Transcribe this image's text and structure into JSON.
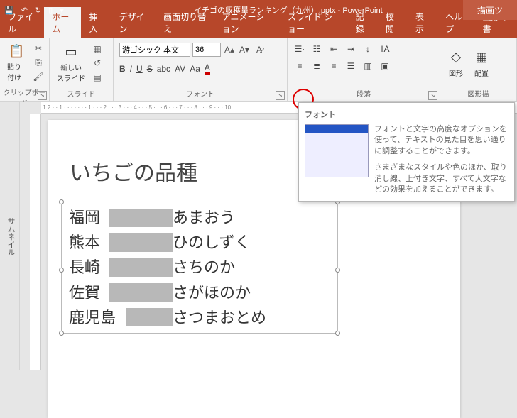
{
  "titlebar": {
    "filename": "イチゴの収穫量ランキング（九州）.pptx - PowerPoint",
    "drawing_tools": "描画ツ"
  },
  "tabs": {
    "file": "ファイル",
    "home": "ホーム",
    "insert": "挿入",
    "design": "デザイン",
    "transitions": "画面切り替え",
    "animations": "アニメーション",
    "slideshow": "スライド ショー",
    "record": "記録",
    "review": "校閲",
    "view": "表示",
    "help": "ヘルプ",
    "format": "図形の書"
  },
  "ribbon": {
    "clipboard": {
      "paste": "貼り付け",
      "label": "クリップボード"
    },
    "slides": {
      "new_slide": "新しい\nスライド",
      "label": "スライド"
    },
    "font": {
      "name": "游ゴシック 本文",
      "size": "36",
      "label": "フォント"
    },
    "paragraph": {
      "label": "段落"
    },
    "shapes": {
      "shape": "図形",
      "arrange": "配置",
      "label": "図形描"
    }
  },
  "slide": {
    "title": "いちごの品種",
    "rows": [
      {
        "a": "福岡",
        "b": "あまおう",
        "w1": 56,
        "gap": 90
      },
      {
        "a": "熊本",
        "b": "ひのしずく",
        "w1": 56,
        "gap": 90
      },
      {
        "a": "長崎",
        "b": "さちのか",
        "w1": 56,
        "gap": 90
      },
      {
        "a": "佐賀",
        "b": "さがほのか",
        "w1": 56,
        "gap": 90
      },
      {
        "a": "鹿児島",
        "b": "さつまおとめ",
        "w1": 80,
        "gap": 66
      }
    ]
  },
  "tooltip": {
    "title": "フォント",
    "line1": "フォントと文字の高度なオプションを使って、テキストの見た目を思い通りに調整することができます。",
    "line2": "さまざまなスタイルや色のほか、取り消し線、上付き文字、すべて大文字などの効果を加えることができます。"
  },
  "thumb_label": "サムネイル"
}
